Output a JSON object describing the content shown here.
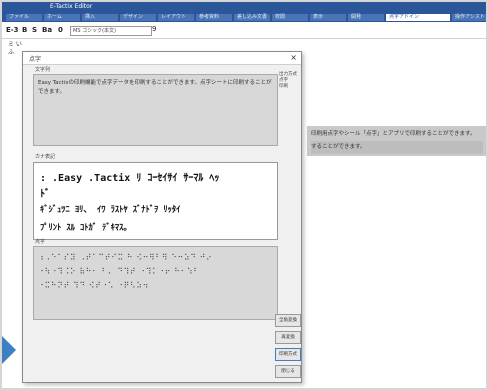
{
  "app": {
    "title": "E-Tactix Editor",
    "ribbon_tabs": [
      "ファイル",
      "ホーム",
      "挿入",
      "デザイン",
      "レイアウト",
      "参考資料",
      "差し込み文書",
      "校閲",
      "表示",
      "開発",
      "点字アドイン",
      "操作アシスト"
    ],
    "active_ribbon_tab_index": 10
  },
  "toolbar": {
    "buttons": [
      "E-3",
      "B",
      "S",
      "Ba",
      "0"
    ],
    "font_select": "MS ゴシック(本文)",
    "font_size": "9"
  },
  "left_gutter": {
    "text": "ミ いふ"
  },
  "document": {
    "lines": [
      "印刷用点字やシール「点字」とアプリで印刷することができます。",
      "することができます。"
    ]
  },
  "dialog": {
    "title": "点字",
    "source_label": "文字列",
    "source_text": "Easy Tactixの印刷機能で点字データを印刷することができます。点字シートに印刷することができます。",
    "kana_label": "カナ表記",
    "kana_lines": [
      ": .Easy .Tactix ﾘ ｺｰｾｲｻｲ ｻｰﾏﾙ ﾍｯ",
      "ﾄﾞ",
      "ｷﾞｼﾞｭﾂﾆ ﾖﾘ、 ｲﾜ ﾗｽﾄﾔ ｽﾞﾅﾄﾞｦ ﾘｯﾀｲ",
      "ﾌﾟﾘﾝﾄ ｽﾙ ｺﾄｶﾞ ﾃﾞｷﾏｽ。"
    ],
    "braille_label": "点字",
    "braille_lines": [
      "⠰⠠⠑⠁⠎⠽ ⠠⠞⠁⠉⠞⠊⠭ ⠓ ⠪⠒⠻⠃⠻ ⠑⠒⠵⠙ ⠚⠔",
      "⠐⠳⠐⠹⠨⠕ ⠷⠓⠂ ⠃⠄ ⠙⠹⠞ ⠐⠹⠅⠐⠖ ⠓⠂⠱⠃",
      "⠐⠭⠓⠝⠞ ⠹⠙ ⠪⠞⠐⠡ ⠐⠟⠣⠵⠲"
    ],
    "side_options": [
      "出力方式",
      "点字",
      "印刷"
    ],
    "buttons": [
      "全角変換",
      "再変換",
      "印刷方式",
      "閉じる"
    ],
    "primary_button_index": 2
  },
  "colors": {
    "title_bar": "#2b579a",
    "accent_arrow": "#3c7fc4",
    "highlight": "#d8001a"
  }
}
